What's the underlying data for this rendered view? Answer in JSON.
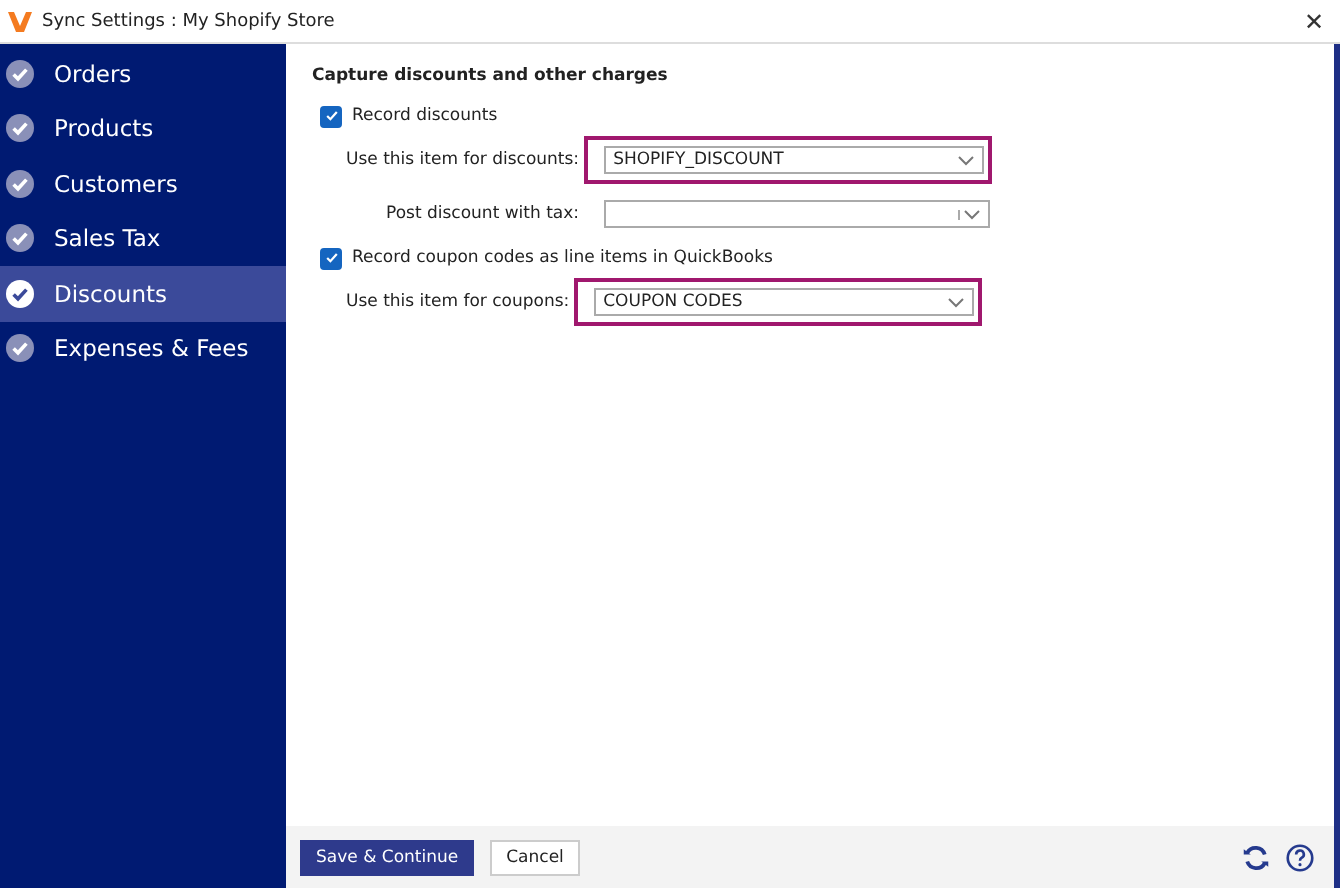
{
  "window": {
    "title": "Sync Settings : My Shopify Store",
    "close": "✕"
  },
  "sidebar": {
    "items": [
      {
        "label": "Orders",
        "selected": false
      },
      {
        "label": "Products",
        "selected": false
      },
      {
        "label": "Customers",
        "selected": false
      },
      {
        "label": "Sales Tax",
        "selected": false
      },
      {
        "label": "Discounts",
        "selected": true
      },
      {
        "label": "Expenses & Fees",
        "selected": false
      }
    ]
  },
  "section_title": "Capture discounts and other charges",
  "settings": [
    {
      "kind": "checkbox",
      "label": "Record discounts",
      "checked": true
    },
    {
      "kind": "select",
      "label": "Use this item for discounts:",
      "value": "SHOPIFY_DISCOUNT",
      "highlighted": true
    },
    {
      "kind": "subselect",
      "label": "Post discount with tax:",
      "highlighted": false
    },
    {
      "kind": "checkbox",
      "label": "Record coupon codes as line items in QuickBooks",
      "checked": true
    },
    {
      "kind": "select",
      "label": "Use this item for coupons:",
      "value": "COUPON CODES",
      "highlighted": true
    }
  ],
  "buttons": [
    {
      "label": "Save & Continue",
      "kind": "primary"
    },
    {
      "label": "Cancel",
      "kind": "secondary"
    }
  ]
}
